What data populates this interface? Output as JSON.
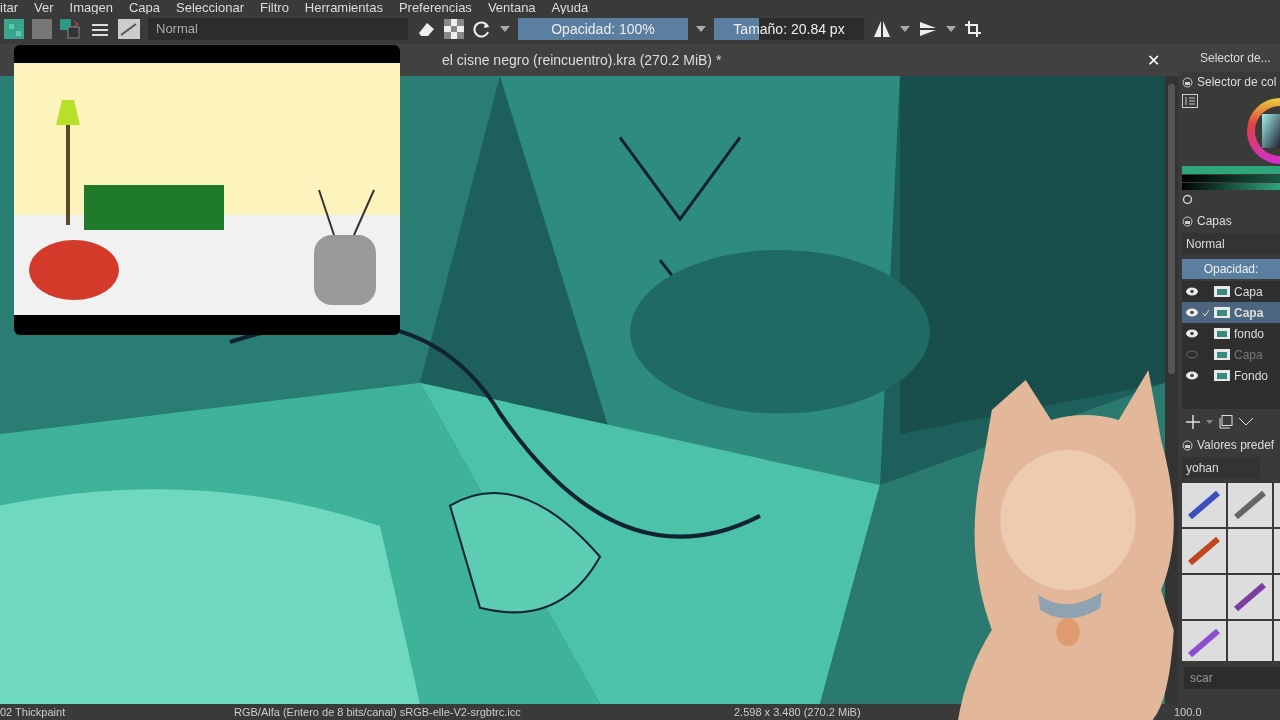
{
  "menu": [
    "itar",
    "Ver",
    "Imagen",
    "Capa",
    "Seleccionar",
    "Filtro",
    "Herramientas",
    "Preferencias",
    "Ventana",
    "Ayuda"
  ],
  "toolbar": {
    "blend_mode": "Normal",
    "opacity": {
      "label": "Opacidad: 100%",
      "level": 1.0
    },
    "size": {
      "label": "Tamaño: 20.84 px",
      "level": 0.3
    }
  },
  "document_tab": {
    "title": "el cisne negro (reincuentro).kra (270.2 MiB) *",
    "close": "✕"
  },
  "docker": {
    "header": "Selector de...",
    "color_selector": {
      "title": "Selector de col"
    },
    "layers": {
      "title": "Capas",
      "blend_mode": "Normal",
      "opacity": {
        "label": "Opacidad:",
        "level": 1.0
      },
      "items": [
        {
          "name": "Capa",
          "visible": true,
          "selected": false
        },
        {
          "name": "Capa",
          "visible": true,
          "selected": true
        },
        {
          "name": "fondo",
          "visible": true,
          "selected": false
        },
        {
          "name": "Capa",
          "visible": false,
          "selected": false
        },
        {
          "name": "Fondo",
          "visible": true,
          "selected": false
        }
      ]
    },
    "presets": {
      "title": "Valores predef",
      "tag": "yohan",
      "search_placeholder": "scar"
    }
  },
  "status_bar": [
    "02 Thickpaint",
    "RGB/Alfa (Entero de 8 bits/canal)  sRGB-elle-V2-srgbtrc.icc",
    "2.598 x 3.480 (270.2 MiB)",
    "100.0"
  ]
}
